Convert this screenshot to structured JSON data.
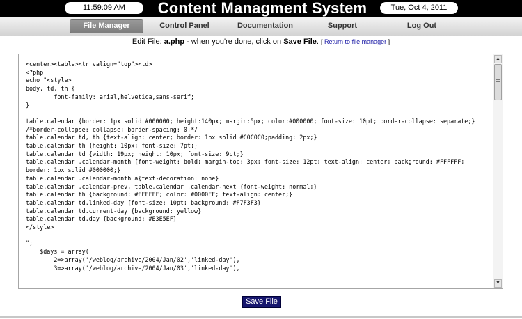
{
  "header": {
    "time": "11:59:09 AM",
    "title": "Content Managment System",
    "date": "Tue, Oct 4, 2011"
  },
  "nav": {
    "items": [
      {
        "label": "File Manager",
        "active": true
      },
      {
        "label": "Control Panel",
        "active": false
      },
      {
        "label": "Documentation",
        "active": false
      },
      {
        "label": "Support",
        "active": false
      },
      {
        "label": "Log Out",
        "active": false
      }
    ]
  },
  "edit_bar": {
    "prefix": "Edit File: ",
    "filename": "a.php",
    "middle": " - when you're done, click on ",
    "action": "Save File",
    "suffix": ". ",
    "return_open": "[ ",
    "return_link": "Return to file manager",
    "return_close": " ]"
  },
  "editor": {
    "content": "<center><table><tr valign=\"top\"><td>\n<?php\necho \"<style>\nbody, td, th {\n        font-family: arial,helvetica,sans-serif;\n}\n\ntable.calendar {border: 1px solid #000000; height:140px; margin:5px; color:#000000; font-size: 10pt; border-collapse: separate;} /*border-collapse: collapse; border-spacing: 0;*/\ntable.calendar td, th {text-align: center; border: 1px solid #C0C0C0;padding: 2px;}\ntable.calendar th {height: 10px; font-size: 7pt;}\ntable.calendar td {width: 19px; height: 10px; font-size: 9pt;}\ntable.calendar .calendar-month {font-weight: bold; margin-top: 3px; font-size: 12pt; text-align: center; background: #FFFFFF; border: 1px solid #000000;}\ntable.calendar .calendar-month a{text-decoration: none}\ntable.calendar .calendar-prev, table.calendar .calendar-next {font-weight: normal;}\ntable.calendar th {background: #FFFFFF; color: #0000FF; text-align: center;}\ntable.calendar td.linked-day {font-size: 10pt; background: #F7F3F3}\ntable.calendar td.current-day {background: yellow}\ntable.calendar td.day {background: #E3E5EF}\n</style>\n\n\";\n    $days = array(\n        2=>array('/weblog/archive/2004/Jan/02','linked-day'),\n        3=>array('/weblog/archive/2004/Jan/03','linked-day'),"
  },
  "save_button": {
    "label": "Save File"
  },
  "scrollbar": {
    "up_arrow": "▲",
    "down_arrow": "▼"
  }
}
